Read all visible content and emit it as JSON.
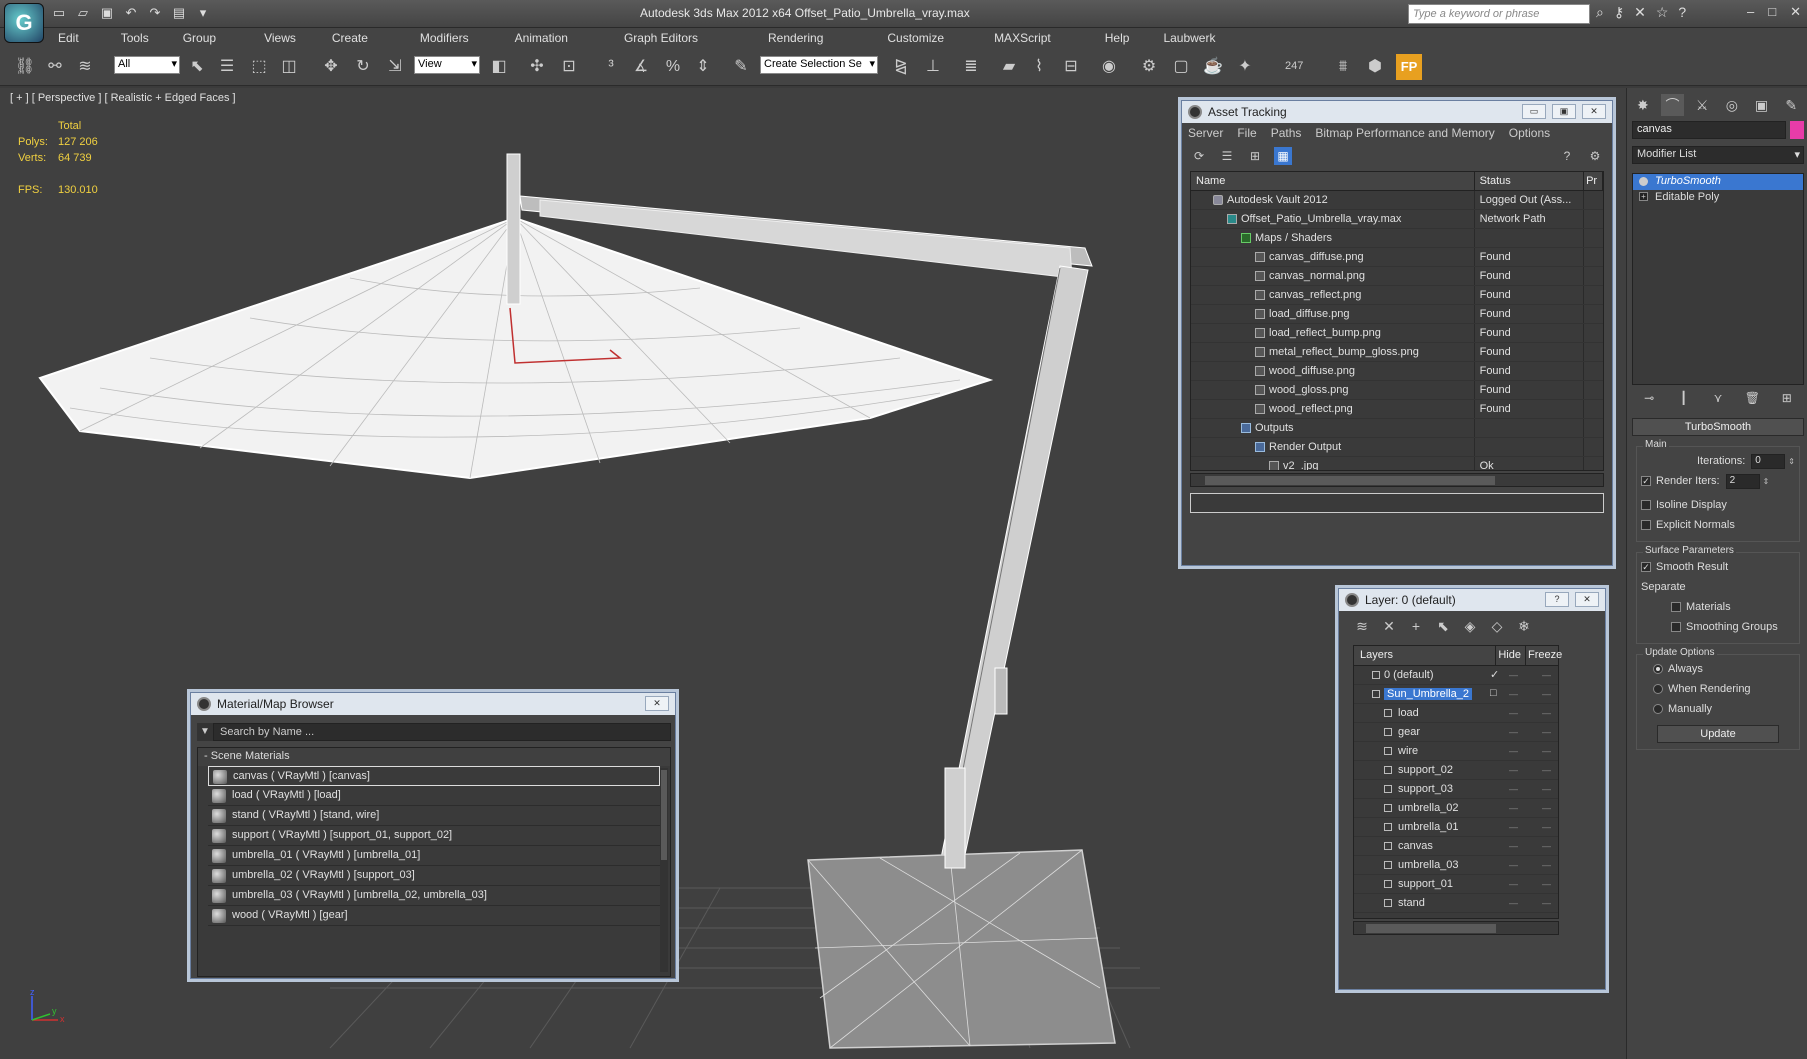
{
  "window": {
    "title": "Autodesk 3ds Max  2012 x64     Offset_Patio_Umbrella_vray.max",
    "search_placeholder": "Type a keyword or phrase",
    "controls": [
      "–",
      "□",
      "✕"
    ]
  },
  "menu": [
    "Edit",
    "Tools",
    "Group",
    "Views",
    "Create",
    "Modifiers",
    "Animation",
    "Graph Editors",
    "Rendering",
    "Customize",
    "MAXScript",
    "Help",
    "Laubwerk"
  ],
  "toolbar": {
    "filter_select": "All",
    "coord_select": "View",
    "selection_set": "Create Selection Se",
    "counter": "247",
    "fp_label": "FP"
  },
  "viewport": {
    "label": "[ + ] [ Perspective ] [ Realistic + Edged Faces ]",
    "stats": {
      "total_label": "Total",
      "polys_label": "Polys:",
      "polys_value": "127 206",
      "verts_label": "Verts:",
      "verts_value": "64 739",
      "fps_label": "FPS:",
      "fps_value": "130.010"
    },
    "axis_x": "x",
    "axis_y": "y",
    "axis_z": "z"
  },
  "command_panel": {
    "object_name": "canvas",
    "object_color": "#e83ca8",
    "modifier_list": "Modifier List",
    "stack": [
      {
        "label": "TurboSmooth",
        "selected": true
      },
      {
        "label": "Editable Poly",
        "selected": false
      }
    ],
    "rollout_title": "TurboSmooth",
    "main_group": "Main",
    "iterations_label": "Iterations:",
    "iterations_value": "0",
    "render_iters_label": "Render Iters:",
    "render_iters_value": "2",
    "isoline_label": "Isoline Display",
    "explicit_normals_label": "Explicit Normals",
    "surface_group": "Surface Parameters",
    "smooth_result_label": "Smooth Result",
    "separate_label": "Separate",
    "materials_label": "Materials",
    "smoothing_groups_label": "Smoothing Groups",
    "update_group": "Update Options",
    "always_label": "Always",
    "when_rendering_label": "When Rendering",
    "manually_label": "Manually",
    "update_button": "Update"
  },
  "asset_tracking": {
    "title": "Asset Tracking",
    "menu": [
      "Server",
      "File",
      "Paths",
      "Bitmap Performance and Memory",
      "Options"
    ],
    "col_name": "Name",
    "col_status": "Status",
    "col_pr": "Pr",
    "rows": [
      {
        "name": "Autodesk Vault 2012",
        "status": "Logged Out (Ass...",
        "indent": 0,
        "icon": "vault"
      },
      {
        "name": "Offset_Patio_Umbrella_vray.max",
        "status": "Network Path",
        "indent": 1,
        "icon": "maxfile"
      },
      {
        "name": "Maps / Shaders",
        "status": "",
        "indent": 2,
        "icon": "folder"
      },
      {
        "name": "canvas_diffuse.png",
        "status": "Found",
        "indent": 3,
        "icon": "map"
      },
      {
        "name": "canvas_normal.png",
        "status": "Found",
        "indent": 3,
        "icon": "map"
      },
      {
        "name": "canvas_reflect.png",
        "status": "Found",
        "indent": 3,
        "icon": "map"
      },
      {
        "name": "load_diffuse.png",
        "status": "Found",
        "indent": 3,
        "icon": "map"
      },
      {
        "name": "load_reflect_bump.png",
        "status": "Found",
        "indent": 3,
        "icon": "map"
      },
      {
        "name": "metal_reflect_bump_gloss.png",
        "status": "Found",
        "indent": 3,
        "icon": "map"
      },
      {
        "name": "wood_diffuse.png",
        "status": "Found",
        "indent": 3,
        "icon": "map"
      },
      {
        "name": "wood_gloss.png",
        "status": "Found",
        "indent": 3,
        "icon": "map"
      },
      {
        "name": "wood_reflect.png",
        "status": "Found",
        "indent": 3,
        "icon": "map"
      },
      {
        "name": "Outputs",
        "status": "",
        "indent": 2,
        "icon": "out"
      },
      {
        "name": "Render Output",
        "status": "",
        "indent": 3,
        "icon": "out"
      },
      {
        "name": "v2_.jpg",
        "status": "Ok",
        "indent": 4,
        "icon": "map"
      }
    ]
  },
  "material_browser": {
    "title": "Material/Map Browser",
    "search_placeholder": "Search by Name ...",
    "group_label": "- Scene Materials",
    "materials": [
      "canvas  ( VRayMtl ) [canvas]",
      "load  ( VRayMtl ) [load]",
      "stand  ( VRayMtl ) [stand, wire]",
      "support  ( VRayMtl ) [support_01, support_02]",
      "umbrella_01  ( VRayMtl ) [umbrella_01]",
      "umbrella_02  ( VRayMtl ) [support_03]",
      "umbrella_03  ( VRayMtl ) [umbrella_02, umbrella_03]",
      "wood  ( VRayMtl ) [gear]"
    ]
  },
  "layer_dialog": {
    "title": "Layer: 0 (default)",
    "col_layers": "Layers",
    "col_hide": "Hide",
    "col_freeze": "Freeze",
    "layers": [
      {
        "name": "0 (default)",
        "level": 0,
        "current": true,
        "selected": false
      },
      {
        "name": "Sun_Umbrella_2",
        "level": 0,
        "current": false,
        "selected": true
      },
      {
        "name": "load",
        "level": 1,
        "current": false,
        "selected": false
      },
      {
        "name": "gear",
        "level": 1,
        "current": false,
        "selected": false
      },
      {
        "name": "wire",
        "level": 1,
        "current": false,
        "selected": false
      },
      {
        "name": "support_02",
        "level": 1,
        "current": false,
        "selected": false
      },
      {
        "name": "support_03",
        "level": 1,
        "current": false,
        "selected": false
      },
      {
        "name": "umbrella_02",
        "level": 1,
        "current": false,
        "selected": false
      },
      {
        "name": "umbrella_01",
        "level": 1,
        "current": false,
        "selected": false
      },
      {
        "name": "canvas",
        "level": 1,
        "current": false,
        "selected": false
      },
      {
        "name": "umbrella_03",
        "level": 1,
        "current": false,
        "selected": false
      },
      {
        "name": "support_01",
        "level": 1,
        "current": false,
        "selected": false
      },
      {
        "name": "stand",
        "level": 1,
        "current": false,
        "selected": false
      }
    ]
  }
}
